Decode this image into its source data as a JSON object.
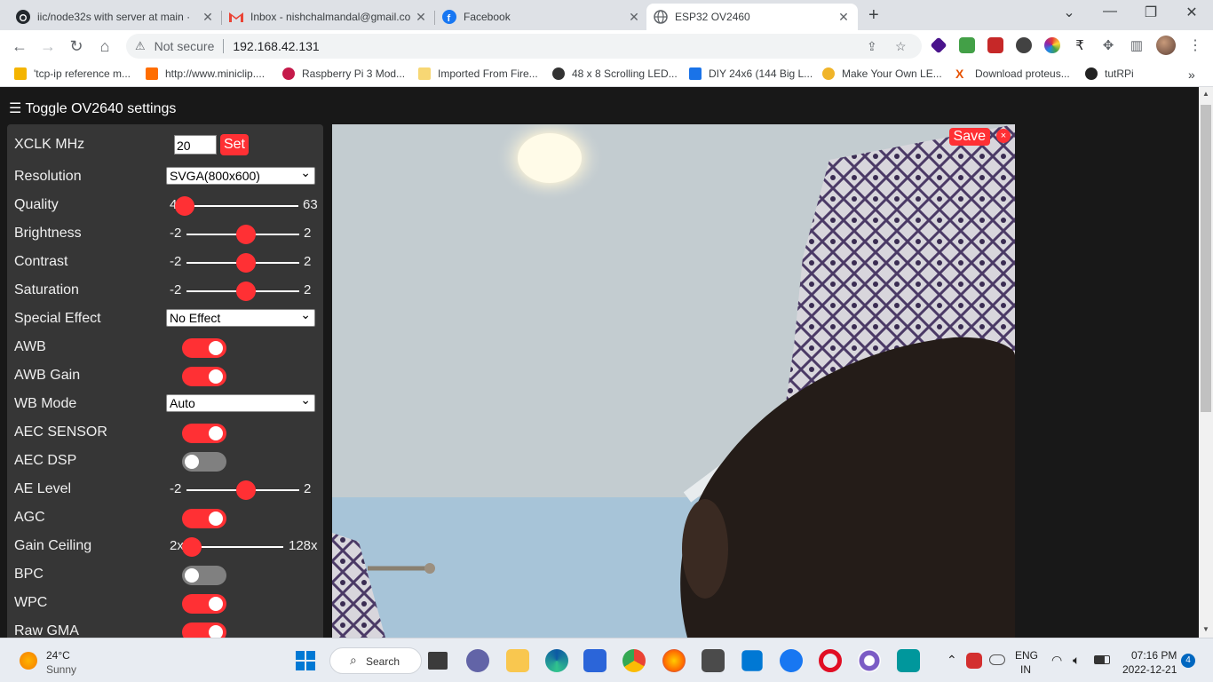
{
  "browser": {
    "tabs": [
      {
        "title": "iic/node32s with server at main ·",
        "icon": "github-icon",
        "active": false
      },
      {
        "title": "Inbox - nishchalmandal@gmail.co",
        "icon": "gmail-icon",
        "active": false
      },
      {
        "title": "Facebook",
        "icon": "facebook-icon",
        "active": false
      },
      {
        "title": "ESP32 OV2460",
        "icon": "globe-icon",
        "active": true
      }
    ],
    "new_tab": "+",
    "address": {
      "security": "Not secure",
      "url": "192.168.42.131"
    },
    "bookmarks": [
      {
        "label": "'tcp-ip reference m...",
        "color": "#f4b400"
      },
      {
        "label": "http://www.miniclip....",
        "color": "#ff6d00"
      },
      {
        "label": "Raspberry Pi 3 Mod...",
        "color": "#c51a4a"
      },
      {
        "label": "Imported From Fire...",
        "color": "#f7d774"
      },
      {
        "label": "48 x 8 Scrolling LED...",
        "color": "#333333"
      },
      {
        "label": "DIY 24x6 (144 Big L...",
        "color": "#1a73e8"
      },
      {
        "label": "Make Your Own LE...",
        "color": "#f0b429"
      },
      {
        "label": "Download proteus...",
        "color": "#e65100"
      },
      {
        "label": "tutRPi",
        "color": "#222222"
      }
    ],
    "more_bookmarks": "»"
  },
  "page": {
    "toggle_label": "Toggle OV2640 settings",
    "xclk": {
      "label": "XCLK MHz",
      "value": "20",
      "button": "Set"
    },
    "resolution": {
      "label": "Resolution",
      "value": "SVGA(800x600)"
    },
    "quality": {
      "label": "Quality",
      "min": "4",
      "max": "63",
      "level": 0.0
    },
    "brightness": {
      "label": "Brightness",
      "min": "-2",
      "max": "2",
      "level": 0.5
    },
    "contrast": {
      "label": "Contrast",
      "min": "-2",
      "max": "2",
      "level": 0.5
    },
    "saturation": {
      "label": "Saturation",
      "min": "-2",
      "max": "2",
      "level": 0.5
    },
    "special_effect": {
      "label": "Special Effect",
      "value": "No Effect"
    },
    "awb": {
      "label": "AWB",
      "on": true
    },
    "awb_gain": {
      "label": "AWB Gain",
      "on": true
    },
    "wb_mode": {
      "label": "WB Mode",
      "value": "Auto"
    },
    "aec_sensor": {
      "label": "AEC SENSOR",
      "on": true
    },
    "aec_dsp": {
      "label": "AEC DSP",
      "on": false
    },
    "ae_level": {
      "label": "AE Level",
      "min": "-2",
      "max": "2",
      "level": 0.5
    },
    "agc": {
      "label": "AGC",
      "on": true
    },
    "gain_ceiling": {
      "label": "Gain Ceiling",
      "min": "2x",
      "max": "128x",
      "level": 0.0
    },
    "bpc": {
      "label": "BPC",
      "on": false
    },
    "wpc": {
      "label": "WPC",
      "on": true
    },
    "raw_gma": {
      "label": "Raw GMA",
      "on": true
    },
    "stream": {
      "save": "Save",
      "close": "×"
    },
    "accent_color": "#ff3034"
  },
  "taskbar": {
    "weather": {
      "temp": "24°C",
      "condition": "Sunny"
    },
    "search": "Search",
    "lang": {
      "line1": "ENG",
      "line2": "IN"
    },
    "clock": {
      "time": "07:16 PM",
      "date": "2022-12-21"
    },
    "notifications": "4"
  }
}
